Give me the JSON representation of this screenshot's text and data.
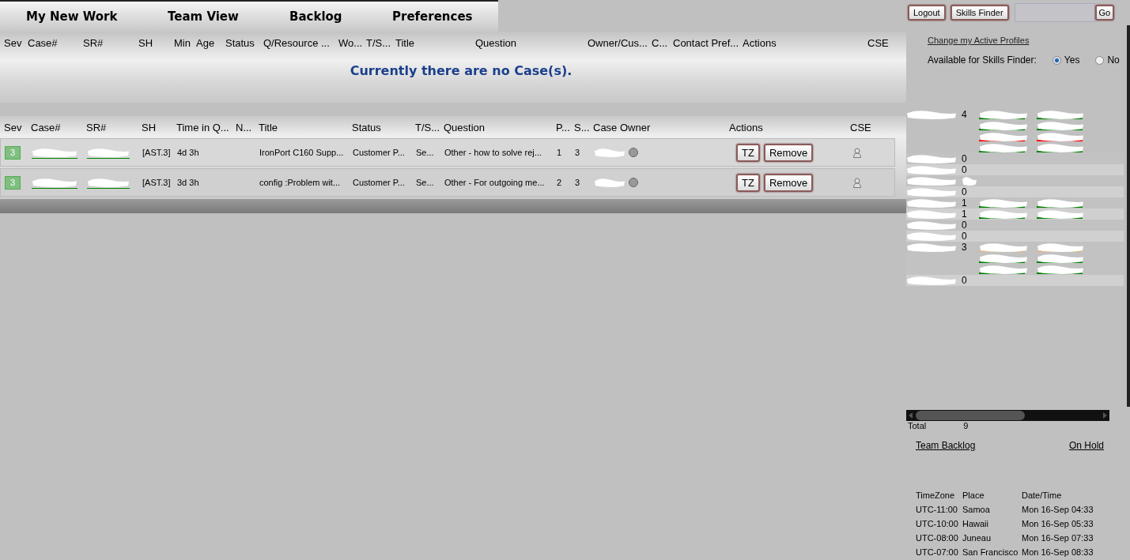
{
  "nav_tabs": [
    "My New Work",
    "Team View",
    "Backlog",
    "Preferences"
  ],
  "top_bar": {
    "buttons": [
      "Logout",
      "Skills Finder"
    ],
    "go_button": "Go"
  },
  "my_cases": {
    "columns": [
      "Sev",
      "Case#",
      "SR#",
      "SH",
      "Min",
      "Age",
      "Status",
      "Q/Resource ...",
      "Wo...",
      "T/S...",
      "Title",
      "Question",
      "Owner/Cus...",
      "C...",
      "Contact Pref...",
      "Actions",
      "CSE"
    ],
    "empty_message": "Currently there are no Case(s)."
  },
  "queue": {
    "columns": [
      "Sev",
      "Case#",
      "SR#",
      "SH",
      "Time in Q...",
      "N...",
      "Title",
      "Status",
      "T/S...",
      "Question",
      "P...",
      "S...",
      "Case Owner",
      "Actions",
      "CSE"
    ],
    "rows": [
      {
        "sev": "3",
        "sh": "[AST.3]",
        "time": "4d 3h",
        "title": "IronPort C160 Supp...",
        "status": "Customer P...",
        "ts": "Se...",
        "question": "Other - how to solve rej...",
        "p": "1",
        "s": "3",
        "actions": [
          "TZ",
          "Remove"
        ]
      },
      {
        "sev": "3",
        "sh": "[AST.3]",
        "time": "3d 3h",
        "title": "config :Problem wit...",
        "status": "Customer P...",
        "ts": "Se...",
        "question": "Other - For outgoing me...",
        "p": "2",
        "s": "3",
        "actions": [
          "TZ",
          "Remove"
        ]
      }
    ]
  },
  "sidebar": {
    "profiles_link": "Change my Active Profiles",
    "availability": {
      "label": "Available for Skills Finder:",
      "options": [
        {
          "label": "Yes",
          "selected": true
        },
        {
          "label": "No",
          "selected": false
        }
      ]
    },
    "engineers": [
      {
        "count": "4",
        "cases": [
          {
            "color": "#008000"
          },
          {
            "color": "#008000"
          },
          {
            "color": "#ff0000"
          },
          {
            "color": "#008000"
          }
        ]
      },
      {
        "count": "0"
      },
      {
        "count": "0"
      },
      {
        "kind": "obscured"
      },
      {
        "count": "0"
      },
      {
        "count": "1",
        "cases": [
          {
            "color": "#008000"
          }
        ]
      },
      {
        "count": "1",
        "cases": [
          {
            "color": "#008000"
          }
        ]
      },
      {
        "count": "0"
      },
      {
        "count": "0"
      },
      {
        "count": "3",
        "cases": [
          {
            "color": "#deb887"
          },
          {
            "color": "#008000"
          },
          {
            "color": "#008000"
          }
        ]
      },
      {
        "count": "0"
      }
    ],
    "total": {
      "label": "Total",
      "value": "9"
    },
    "links": [
      "Team Backlog",
      "On Hold"
    ],
    "timezones": {
      "columns": [
        "TimeZone",
        "Place",
        "Date/Time"
      ],
      "rows": [
        [
          "UTC-11:00",
          "Samoa",
          "Mon 16-Sep 04:33"
        ],
        [
          "UTC-10:00",
          "Hawaii",
          "Mon 16-Sep 05:33"
        ],
        [
          "UTC-08:00",
          "Juneau",
          "Mon 16-Sep 07:33"
        ],
        [
          "UTC-07:00",
          "San Francisco",
          "Mon 16-Sep 08:33"
        ]
      ]
    }
  }
}
